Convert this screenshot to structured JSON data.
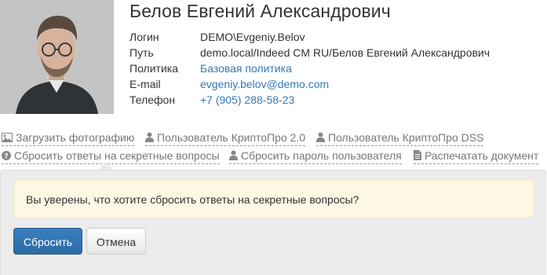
{
  "user": {
    "name": "Белов Евгений Александрович",
    "fields": [
      {
        "label": "Логин",
        "value": "DEMO\\Evgeniy.Belov"
      },
      {
        "label": "Путь",
        "value": "demo.local/Indeed CM RU/Белов Евгений Александрович"
      },
      {
        "label": "Политика",
        "value": "Базовая политика"
      },
      {
        "label": "E-mail",
        "value": "evgeniy.belov@demo.com"
      },
      {
        "label": "Телефон",
        "value": "+7 (905) 288-58-23"
      }
    ]
  },
  "actions": {
    "upload_photo": "Загрузить фотографию",
    "cryptopro_user": "Пользователь КриптоПро 2.0",
    "cryptopro_dss_user": "Пользователь КриптоПро DSS",
    "reset_answers": "Сбросить ответы на секретные вопросы",
    "reset_password": "Сбросить пароль пользователя",
    "print_document": "Распечатать документ"
  },
  "confirm": {
    "message": "Вы уверены, что хотите сбросить ответы на секретные вопросы?",
    "reset_label": "Сбросить",
    "cancel_label": "Отмена"
  },
  "colors": {
    "link": "#337ab7",
    "primary_button": "#2e6da4",
    "alert_background": "#fcf8e3"
  },
  "icons": [
    "image-icon",
    "user-icon",
    "question-circle-icon",
    "file-icon"
  ]
}
